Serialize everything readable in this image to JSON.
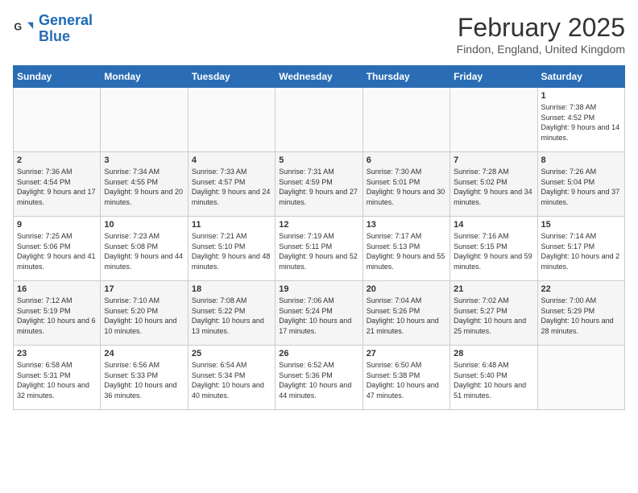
{
  "header": {
    "logo_line1": "General",
    "logo_line2": "Blue",
    "title": "February 2025",
    "subtitle": "Findon, England, United Kingdom"
  },
  "weekdays": [
    "Sunday",
    "Monday",
    "Tuesday",
    "Wednesday",
    "Thursday",
    "Friday",
    "Saturday"
  ],
  "weeks": [
    [
      {
        "day": "",
        "info": ""
      },
      {
        "day": "",
        "info": ""
      },
      {
        "day": "",
        "info": ""
      },
      {
        "day": "",
        "info": ""
      },
      {
        "day": "",
        "info": ""
      },
      {
        "day": "",
        "info": ""
      },
      {
        "day": "1",
        "info": "Sunrise: 7:38 AM\nSunset: 4:52 PM\nDaylight: 9 hours and 14 minutes."
      }
    ],
    [
      {
        "day": "2",
        "info": "Sunrise: 7:36 AM\nSunset: 4:54 PM\nDaylight: 9 hours and 17 minutes."
      },
      {
        "day": "3",
        "info": "Sunrise: 7:34 AM\nSunset: 4:55 PM\nDaylight: 9 hours and 20 minutes."
      },
      {
        "day": "4",
        "info": "Sunrise: 7:33 AM\nSunset: 4:57 PM\nDaylight: 9 hours and 24 minutes."
      },
      {
        "day": "5",
        "info": "Sunrise: 7:31 AM\nSunset: 4:59 PM\nDaylight: 9 hours and 27 minutes."
      },
      {
        "day": "6",
        "info": "Sunrise: 7:30 AM\nSunset: 5:01 PM\nDaylight: 9 hours and 30 minutes."
      },
      {
        "day": "7",
        "info": "Sunrise: 7:28 AM\nSunset: 5:02 PM\nDaylight: 9 hours and 34 minutes."
      },
      {
        "day": "8",
        "info": "Sunrise: 7:26 AM\nSunset: 5:04 PM\nDaylight: 9 hours and 37 minutes."
      }
    ],
    [
      {
        "day": "9",
        "info": "Sunrise: 7:25 AM\nSunset: 5:06 PM\nDaylight: 9 hours and 41 minutes."
      },
      {
        "day": "10",
        "info": "Sunrise: 7:23 AM\nSunset: 5:08 PM\nDaylight: 9 hours and 44 minutes."
      },
      {
        "day": "11",
        "info": "Sunrise: 7:21 AM\nSunset: 5:10 PM\nDaylight: 9 hours and 48 minutes."
      },
      {
        "day": "12",
        "info": "Sunrise: 7:19 AM\nSunset: 5:11 PM\nDaylight: 9 hours and 52 minutes."
      },
      {
        "day": "13",
        "info": "Sunrise: 7:17 AM\nSunset: 5:13 PM\nDaylight: 9 hours and 55 minutes."
      },
      {
        "day": "14",
        "info": "Sunrise: 7:16 AM\nSunset: 5:15 PM\nDaylight: 9 hours and 59 minutes."
      },
      {
        "day": "15",
        "info": "Sunrise: 7:14 AM\nSunset: 5:17 PM\nDaylight: 10 hours and 2 minutes."
      }
    ],
    [
      {
        "day": "16",
        "info": "Sunrise: 7:12 AM\nSunset: 5:19 PM\nDaylight: 10 hours and 6 minutes."
      },
      {
        "day": "17",
        "info": "Sunrise: 7:10 AM\nSunset: 5:20 PM\nDaylight: 10 hours and 10 minutes."
      },
      {
        "day": "18",
        "info": "Sunrise: 7:08 AM\nSunset: 5:22 PM\nDaylight: 10 hours and 13 minutes."
      },
      {
        "day": "19",
        "info": "Sunrise: 7:06 AM\nSunset: 5:24 PM\nDaylight: 10 hours and 17 minutes."
      },
      {
        "day": "20",
        "info": "Sunrise: 7:04 AM\nSunset: 5:26 PM\nDaylight: 10 hours and 21 minutes."
      },
      {
        "day": "21",
        "info": "Sunrise: 7:02 AM\nSunset: 5:27 PM\nDaylight: 10 hours and 25 minutes."
      },
      {
        "day": "22",
        "info": "Sunrise: 7:00 AM\nSunset: 5:29 PM\nDaylight: 10 hours and 28 minutes."
      }
    ],
    [
      {
        "day": "23",
        "info": "Sunrise: 6:58 AM\nSunset: 5:31 PM\nDaylight: 10 hours and 32 minutes."
      },
      {
        "day": "24",
        "info": "Sunrise: 6:56 AM\nSunset: 5:33 PM\nDaylight: 10 hours and 36 minutes."
      },
      {
        "day": "25",
        "info": "Sunrise: 6:54 AM\nSunset: 5:34 PM\nDaylight: 10 hours and 40 minutes."
      },
      {
        "day": "26",
        "info": "Sunrise: 6:52 AM\nSunset: 5:36 PM\nDaylight: 10 hours and 44 minutes."
      },
      {
        "day": "27",
        "info": "Sunrise: 6:50 AM\nSunset: 5:38 PM\nDaylight: 10 hours and 47 minutes."
      },
      {
        "day": "28",
        "info": "Sunrise: 6:48 AM\nSunset: 5:40 PM\nDaylight: 10 hours and 51 minutes."
      },
      {
        "day": "",
        "info": ""
      }
    ]
  ]
}
